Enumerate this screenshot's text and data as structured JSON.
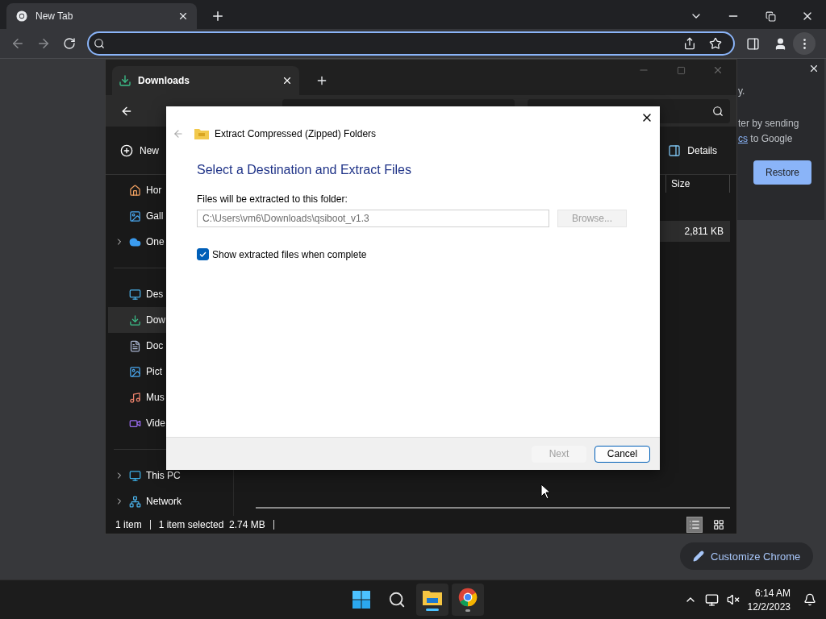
{
  "browser": {
    "tab": {
      "title": "New Tab"
    }
  },
  "side_panel": {
    "line_1": "y.",
    "line_2": "ter by sending",
    "link": "cs",
    "line_3_tail": " to Google",
    "button": "Restore"
  },
  "customize_button": "Customize Chrome",
  "explorer": {
    "tab": "Downloads",
    "commands": [
      {
        "kind": "new",
        "label": "New"
      },
      {
        "kind": "details",
        "label": "Details"
      }
    ],
    "sidebar": [
      [
        {
          "kind": "home",
          "label": "Hor",
          "expandable": false,
          "selected": false
        },
        {
          "kind": "gallery",
          "label": "Gall",
          "expandable": false,
          "selected": false
        },
        {
          "kind": "cloud",
          "label": "One",
          "expandable": true,
          "selected": false
        }
      ],
      [
        {
          "kind": "desktop",
          "label": "Des",
          "expandable": false,
          "selected": false
        },
        {
          "kind": "download",
          "label": "Dow",
          "expandable": false,
          "selected": true
        },
        {
          "kind": "document",
          "label": "Doc",
          "expandable": false,
          "selected": false
        },
        {
          "kind": "pictures",
          "label": "Pict",
          "expandable": false,
          "selected": false
        },
        {
          "kind": "music",
          "label": "Mus",
          "expandable": false,
          "selected": false
        },
        {
          "kind": "videos",
          "label": "Vide",
          "expandable": false,
          "selected": false
        }
      ],
      [
        {
          "kind": "pc",
          "label": "This PC",
          "expandable": true,
          "selected": false
        },
        {
          "kind": "network",
          "label": "Network",
          "expandable": true,
          "selected": false
        }
      ]
    ],
    "column": "Size",
    "rows": [
      {
        "size": "2,811 KB",
        "selected": true
      }
    ],
    "status": [
      "1 item",
      "1 item selected  2.74 MB"
    ],
    "view_buttons": [
      {
        "kind": "details",
        "selected": true
      },
      {
        "kind": "tiles",
        "selected": false
      }
    ]
  },
  "dialog": {
    "title": "Extract Compressed (Zipped) Folders",
    "heading": "Select a Destination and Extract Files",
    "field_label": "Files will be extracted to this folder:",
    "path": "C:\\Users\\vm6\\Downloads\\qsiboot_v1.3",
    "browse": "Browse...",
    "checkbox": {
      "label": "Show extracted files when complete",
      "checked": true
    },
    "buttons": [
      {
        "label": "Next",
        "disabled": true
      },
      {
        "label": "Cancel",
        "disabled": false
      }
    ]
  },
  "taskbar": {
    "apps": [
      {
        "kind": "start"
      },
      {
        "kind": "search"
      },
      {
        "kind": "explorer",
        "active": true
      },
      {
        "kind": "chrome",
        "active": false
      }
    ],
    "time": "6:14 AM",
    "date": "12/2/2023"
  }
}
